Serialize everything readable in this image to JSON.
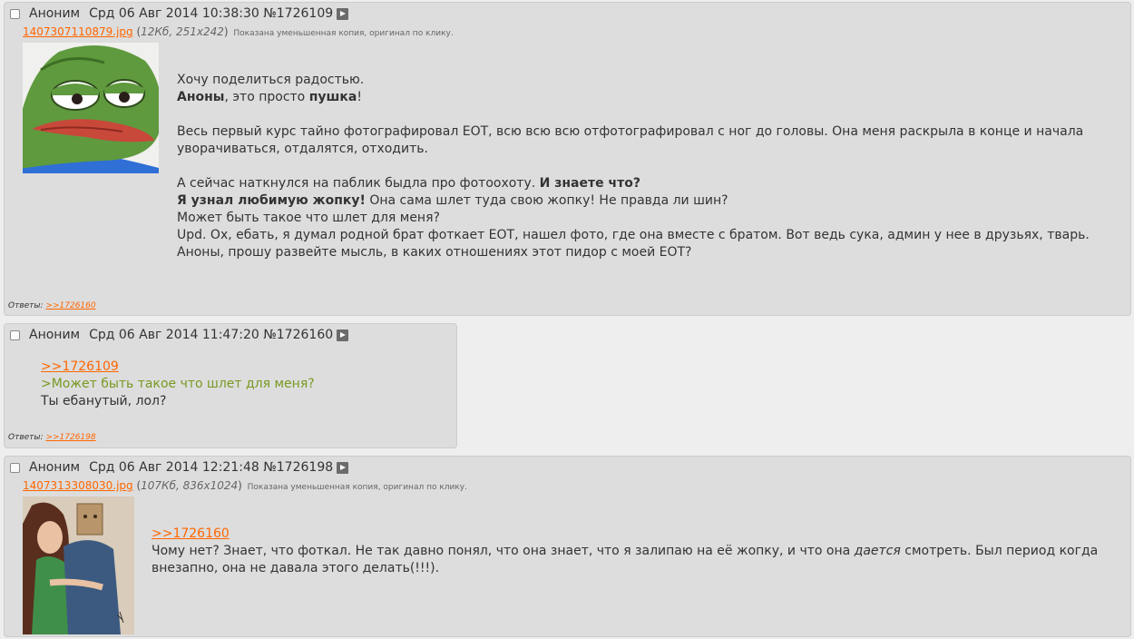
{
  "posts": [
    {
      "name": "Аноним",
      "date": "Срд 06 Авг 2014 10:38:30",
      "num": "№1726109",
      "file": {
        "name": "1407307110879.jpg",
        "meta": "12Кб, 251x242",
        "hint": "Показана уменьшенная копия, оригинал по клику.",
        "image": "pepe-frog"
      },
      "lines": {
        "l1": "Хочу поделиться радостью.",
        "l2a": "Аноны",
        "l2b": ", это просто ",
        "l2c": "пушка",
        "l2d": "!",
        "l3": "Весь первый курс тайно фотографировал ЕОТ, всю всю всю отфотографировал с ног до головы. Она меня раскрыла в конце и начала уворачиваться, отдалятся, отходить.",
        "l4a": "А сейчас наткнулся на паблик быдла про фотоохоту. ",
        "l4b": "И знаете что?",
        "l5a": "Я узнал любимую жопку!",
        "l5b": " Она сама шлет туда свою жопку! Не правда ли шин?",
        "l6": "Может быть такое что шлет для меня?",
        "l7": "Upd. Ох, ебать, я думал родной брат фоткает ЕОТ, нашел фото, где она вместе с братом. Вот ведь сука, админ у нее в друзьях, тварь.",
        "l8": "Аноны, прошу развейте мысль, в каких отношениях этот пидор с моей ЕОТ?"
      },
      "replies_label": "Ответы:",
      "replies_link": ">>1726160"
    },
    {
      "name": "Аноним",
      "date": "Срд 06 Авг 2014 11:47:20",
      "num": "№1726160",
      "ref": ">>1726109",
      "quote": ">Может быть такое что шлет для меня?",
      "text": "Ты ебанутый, лол?",
      "replies_label": "Ответы:",
      "replies_link": ">>1726198"
    },
    {
      "name": "Аноним",
      "date": "Срд 06 Авг 2014 12:21:48",
      "num": "№1726198",
      "file": {
        "name": "1407313308030.jpg",
        "meta": "107Кб, 836x1024",
        "hint": "Показана уменьшенная копия, оригинал по клику.",
        "image": "couple-drawing"
      },
      "ref": ">>1726160",
      "text_a": "Чому нет? Знает, что фоткал. Не так давно понял, что она знает, что я залипаю на её жопку, и что она ",
      "text_em": "дается",
      "text_b": " смотреть. Был период когда внезапно, она не давала этого делать(!!!)."
    }
  ],
  "colors": {
    "post_bg": "#dddddd",
    "link": "#ff6600",
    "quote": "#789922"
  }
}
